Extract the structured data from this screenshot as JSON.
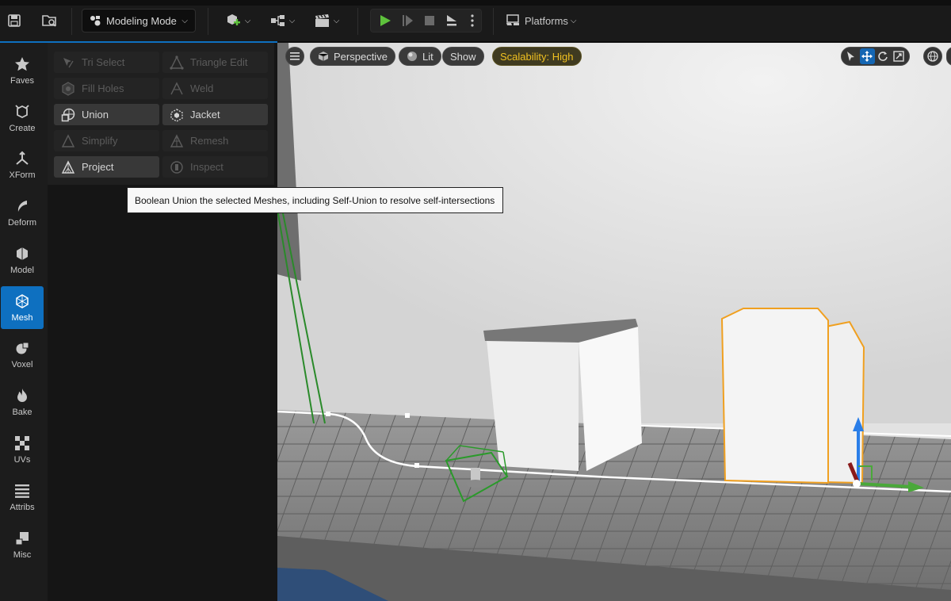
{
  "toolbar": {
    "mode_label": "Modeling Mode",
    "platforms_label": "Platforms"
  },
  "tabs": [
    {
      "label": "Faves",
      "icon": "star-icon"
    },
    {
      "label": "Create",
      "icon": "create-icon"
    },
    {
      "label": "XForm",
      "icon": "xform-icon"
    },
    {
      "label": "Deform",
      "icon": "deform-icon"
    },
    {
      "label": "Model",
      "icon": "model-icon"
    },
    {
      "label": "Mesh",
      "icon": "mesh-icon",
      "active": true
    },
    {
      "label": "Voxel",
      "icon": "voxel-icon"
    },
    {
      "label": "Bake",
      "icon": "bake-icon"
    },
    {
      "label": "UVs",
      "icon": "uvs-icon"
    },
    {
      "label": "Attribs",
      "icon": "attribs-icon"
    },
    {
      "label": "Misc",
      "icon": "misc-icon"
    }
  ],
  "tools": [
    {
      "label": "Tri Select",
      "enabled": false
    },
    {
      "label": "Triangle Edit",
      "enabled": false
    },
    {
      "label": "Fill Holes",
      "enabled": false
    },
    {
      "label": "Weld",
      "enabled": false
    },
    {
      "label": "Union",
      "enabled": true
    },
    {
      "label": "Jacket",
      "enabled": true
    },
    {
      "label": "Simplify",
      "enabled": false
    },
    {
      "label": "Remesh",
      "enabled": false
    },
    {
      "label": "Project",
      "enabled": true
    },
    {
      "label": "Inspect",
      "enabled": false
    }
  ],
  "viewport": {
    "perspective_label": "Perspective",
    "lit_label": "Lit",
    "show_label": "Show",
    "scalability_label": "Scalability: High"
  },
  "tooltip": {
    "text": "Boolean Union the selected Meshes, including Self-Union to resolve self-intersections"
  },
  "colors": {
    "accent": "#0e70c0",
    "play_green": "#5ec23c",
    "selection_orange": "#f0a020",
    "scalability_yellow": "#f0c020"
  }
}
